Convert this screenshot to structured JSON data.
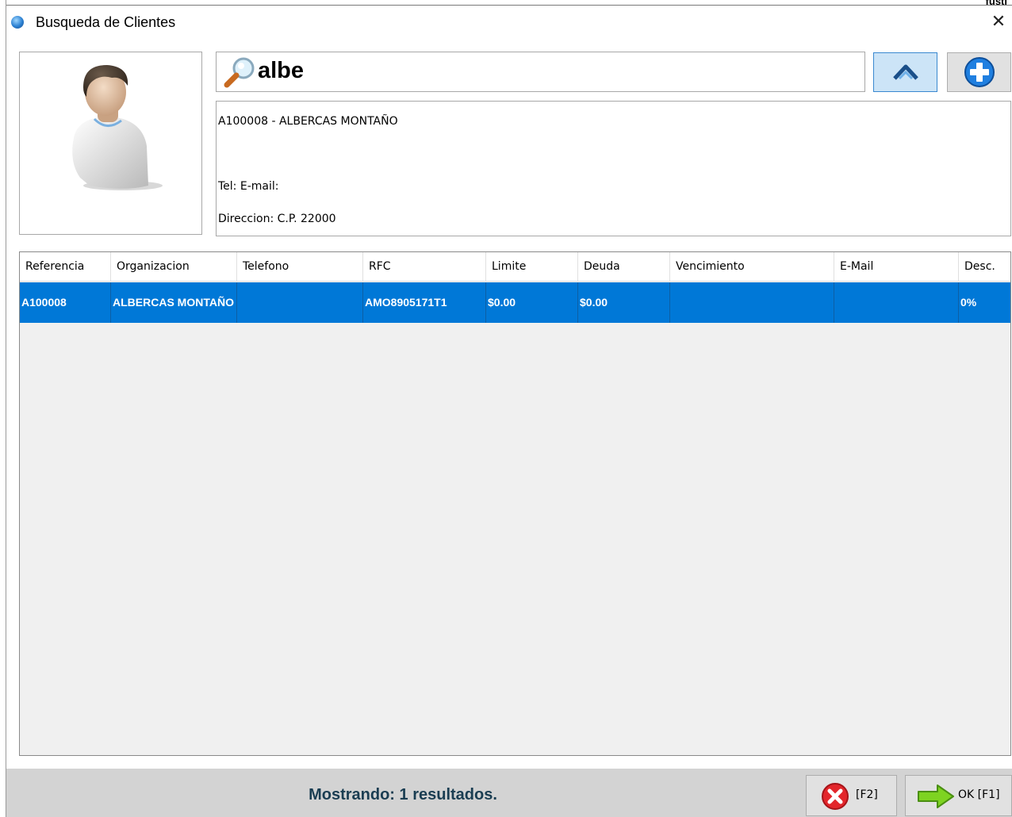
{
  "window": {
    "title": "Busqueda de Clientes",
    "corner_text": "fusti"
  },
  "search": {
    "value": "albe"
  },
  "selected_client": {
    "header": "A100008 - ALBERCAS MONTAÑO",
    "contact": "Tel:  E-mail:",
    "address": "Direccion:  C.P. 22000"
  },
  "table": {
    "columns": [
      "Referencia",
      "Organizacion",
      "Telefono",
      "RFC",
      "Limite",
      "Deuda",
      "Vencimiento",
      "E-Mail",
      "Desc."
    ],
    "rows": [
      {
        "referencia": "A100008",
        "organizacion": "ALBERCAS MONTAÑO",
        "telefono": "",
        "rfc": "AMO8905171T1",
        "limite": "$0.00",
        "deuda": "$0.00",
        "vencimiento": "",
        "email": "",
        "desc": "0%"
      }
    ]
  },
  "status": {
    "text": "Mostrando: 1 resultados."
  },
  "buttons": {
    "cancel_label": "[F2]",
    "ok_label": "OK [F1]"
  },
  "colors": {
    "selection": "#0078d7",
    "status_text": "#1a3d52",
    "status_bar": "#d3d3d3"
  }
}
